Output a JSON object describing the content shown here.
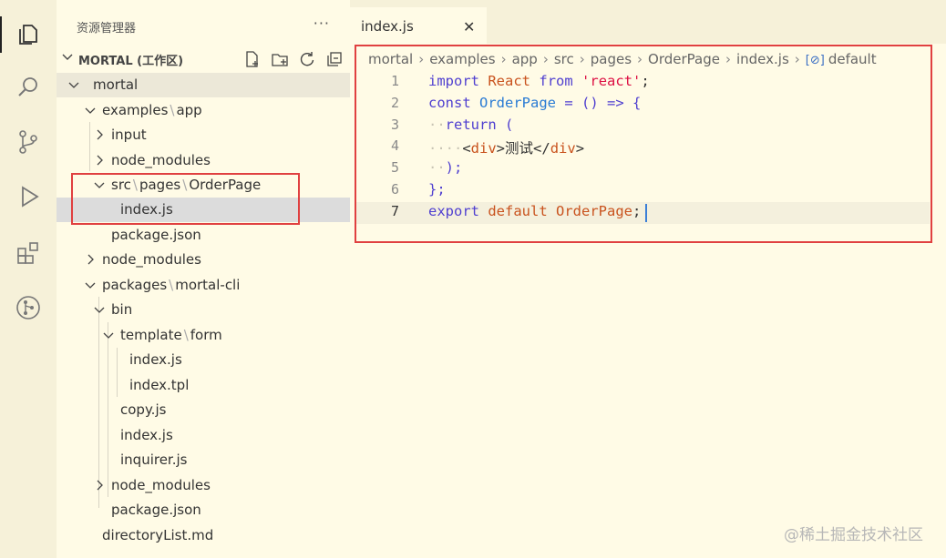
{
  "activity_bar": {
    "icons": [
      "explorer-icon",
      "search-icon",
      "source-control-icon",
      "run-debug-icon",
      "extensions-icon",
      "git-graph-icon"
    ]
  },
  "sidebar": {
    "title": "资源管理器",
    "more": "···",
    "workspace_label": "MORTAL (工作区)",
    "tree": {
      "r0": "mortal",
      "r1a": "examples",
      "r1b": "app",
      "r2": "input",
      "r3": "node_modules",
      "r4a": "src",
      "r4b": "pages",
      "r4c": "OrderPage",
      "r5": "index.js",
      "r6": "package.json",
      "r7": "node_modules",
      "r8a": "packages",
      "r8b": "mortal-cli",
      "r9": "bin",
      "r10a": "template",
      "r10b": "form",
      "r11": "index.js",
      "r12": "index.tpl",
      "r13": "copy.js",
      "r14": "index.js",
      "r15": "inquirer.js",
      "r16": "node_modules",
      "r17": "package.json",
      "r18": "directoryList.md"
    }
  },
  "editor": {
    "tab_label": "index.js",
    "tab_close": "✕",
    "breadcrumb": [
      "mortal",
      "examples",
      "app",
      "src",
      "pages",
      "OrderPage",
      "index.js",
      "default"
    ],
    "line_numbers": [
      "1",
      "2",
      "3",
      "4",
      "5",
      "6",
      "7"
    ],
    "code": {
      "l1_import": "import",
      "l1_react": "React",
      "l1_from": "from",
      "l1_str": "'react'",
      "l1_end": ";",
      "l2_const": "const",
      "l2_name": "OrderPage",
      "l2_rest": "= () => {",
      "l3_return": "return",
      "l3_paren": "(",
      "l4_open_lt": "<",
      "l4_open_tag": "div",
      "l4_open_gt": ">",
      "l4_text": "测试",
      "l4_close_lt": "</",
      "l4_close_tag": "div",
      "l4_close_gt": ">",
      "l5": ");",
      "l6": "};",
      "l7_export": "export",
      "l7_default": "default",
      "l7_name": "OrderPage",
      "l7_end": ";"
    }
  },
  "watermark": "@稀土掘金技术社区",
  "colors": {
    "highlight_box": "#e04040",
    "keyword": "#4f3fd0",
    "identifier": "#2a7bd4",
    "string": "#d14",
    "background": "#fffbe6"
  }
}
